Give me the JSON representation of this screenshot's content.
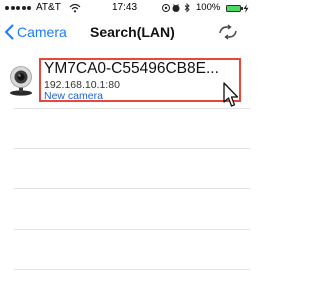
{
  "status_bar": {
    "carrier": "AT&T",
    "time": "17:43",
    "battery_percent": "100%",
    "icons": [
      "signal-dots",
      "wifi-icon",
      "location-icon",
      "alarm-icon",
      "bluetooth-icon",
      "battery-icon",
      "charging-icon"
    ]
  },
  "nav": {
    "back_label": "Camera",
    "title": "Search(LAN)",
    "refresh_icon": "refresh-arrows-icon"
  },
  "list": {
    "items": [
      {
        "name": "YM7CA0-C55496CB8E...",
        "address": "192.168.10.1:80",
        "label": "New camera",
        "icon": "webcam-icon"
      }
    ],
    "empty_rows": 5
  },
  "colors": {
    "accent": "#1b7cf5",
    "highlight": "#e8473d",
    "battery": "#4cd964",
    "divider": "#e3e3e3"
  }
}
